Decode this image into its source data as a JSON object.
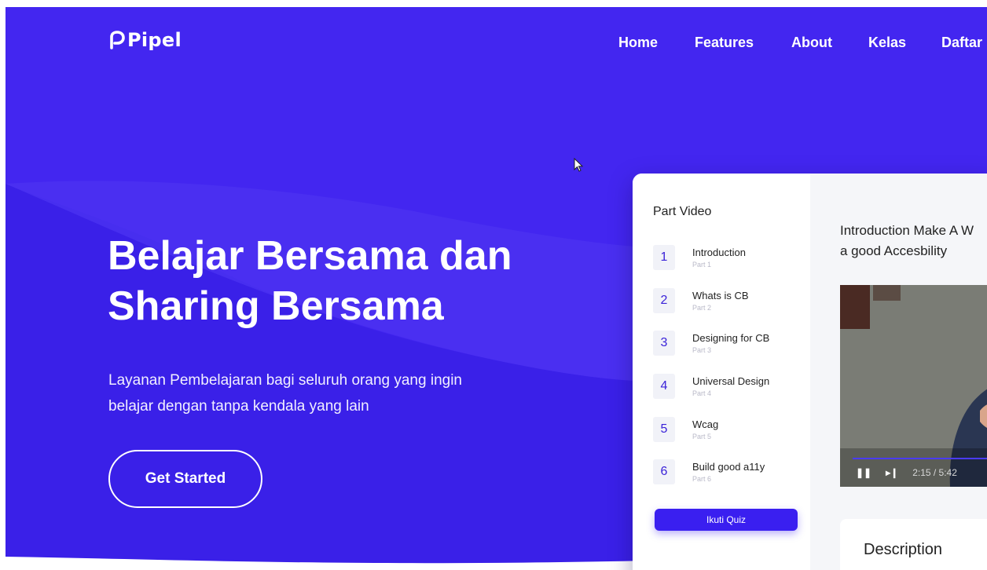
{
  "brand": {
    "name": "Pipel",
    "color": "#4326f0"
  },
  "nav": {
    "items": [
      {
        "label": "Home"
      },
      {
        "label": "Features"
      },
      {
        "label": "About"
      },
      {
        "label": "Kelas"
      },
      {
        "label": "Daftar"
      }
    ]
  },
  "hero": {
    "title_line1": "Belajar Bersama dan",
    "title_line2": "Sharing Bersama",
    "subtitle_line1": "Layanan Pembelajaran bagi seluruh orang yang ingin",
    "subtitle_line2": "belajar dengan tanpa kendala yang lain",
    "cta_label": "Get Started"
  },
  "course_card": {
    "part_title": "Part Video",
    "parts": [
      {
        "num": "1",
        "name": "Introduction",
        "sub": "Part 1"
      },
      {
        "num": "2",
        "name": "Whats is CB",
        "sub": "Part 2"
      },
      {
        "num": "3",
        "name": "Designing for CB",
        "sub": "Part 3"
      },
      {
        "num": "4",
        "name": "Universal Design",
        "sub": "Part 4"
      },
      {
        "num": "5",
        "name": "Wcag",
        "sub": "Part 5"
      },
      {
        "num": "6",
        "name": "Build good a11y",
        "sub": "Part 6"
      }
    ],
    "quiz_label": "Ikuti Quiz",
    "video_title_line1": "Introduction Make A W",
    "video_title_line2": "a good Accesbility",
    "video_time": "2:15 / 5:42",
    "description_title": "Description"
  }
}
